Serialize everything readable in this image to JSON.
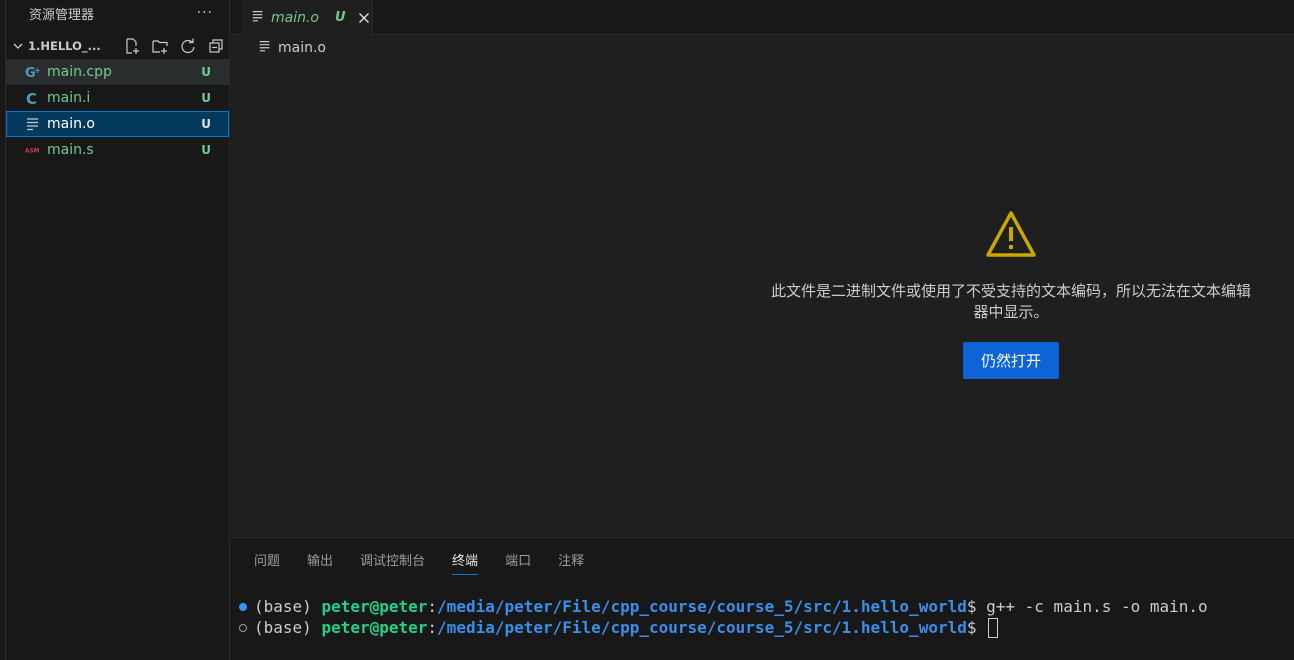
{
  "sidebar": {
    "title": "资源管理器",
    "more_label": "···",
    "folder": {
      "name": "1.HELLO_...",
      "actions": [
        {
          "name": "new-file-icon"
        },
        {
          "name": "new-folder-icon"
        },
        {
          "name": "refresh-icon"
        },
        {
          "name": "collapse-all-icon"
        }
      ]
    },
    "files": [
      {
        "name": "main.cpp",
        "badge": "U",
        "icon": "cpp-icon",
        "icon_color": "#519aba"
      },
      {
        "name": "main.i",
        "badge": "U",
        "icon": "c-icon",
        "icon_color": "#519aba"
      },
      {
        "name": "main.o",
        "badge": "U",
        "icon": "lines-icon",
        "icon_color": "#cccccc"
      },
      {
        "name": "main.s",
        "badge": "U",
        "icon": "asm-icon",
        "icon_color": "#cc3e44"
      }
    ]
  },
  "tab": {
    "name": "main.o",
    "badge": "U"
  },
  "breadcrumb": {
    "label": "main.o"
  },
  "editor": {
    "warning_line1": "此文件是二进制文件或使用了不受支持的文本编码，所以无法在文本编辑",
    "warning_line2": "器中显示。",
    "open_button": "仍然打开"
  },
  "panel": {
    "tabs": [
      "问题",
      "输出",
      "调试控制台",
      "终端",
      "端口",
      "注释"
    ],
    "active_tab": "终端",
    "terminal": [
      {
        "env": "(base) ",
        "user": "peter@peter",
        "sep": ":",
        "path": "/media/peter/File/cpp_course/course_5/src/1.hello_world",
        "prompt": "$ ",
        "cmd": "g++ -c main.s -o main.o"
      },
      {
        "env": "(base) ",
        "user": "peter@peter",
        "sep": ":",
        "path": "/media/peter/File/cpp_course/course_5/src/1.hello_world",
        "prompt": "$ ",
        "cmd": ""
      }
    ]
  },
  "colors": {
    "accent": "#0078d4",
    "untracked": "#73c991",
    "button": "#0e63d6",
    "warning": "#cca700"
  }
}
